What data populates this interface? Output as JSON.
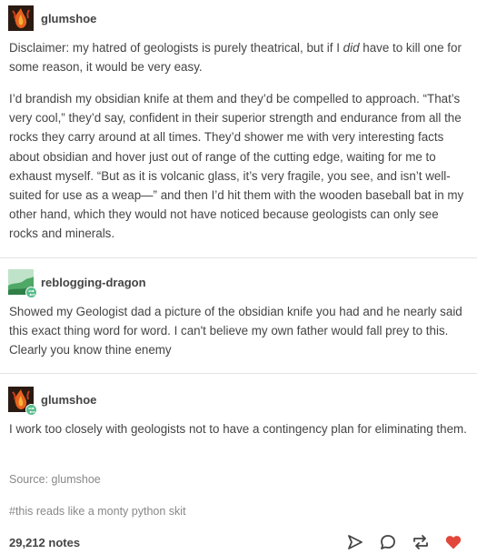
{
  "post1": {
    "username": "glumshoe",
    "para1_before": "Disclaimer: my hatred of geologists is purely theatrical, but if I ",
    "para1_em": "did",
    "para1_after": " have to kill one for some reason, it would be very easy.",
    "para2": "I’d brandish my obsidian knife at them and they’d be compelled to approach. “That’s very cool,” they’d say, confident in their superior strength and endurance from all the rocks they carry around at all times. They’d shower me with very interesting facts about obsidian and hover just out of range of the cutting edge, waiting for me to exhaust myself. “But as it is volcanic glass, it’s very fragile, you see, and isn’t well-suited for use as a weap—” and then I’d hit them with the wooden baseball bat in my other hand, which they would not have noticed because geologists can only see rocks and minerals."
  },
  "post2": {
    "username": "reblogging-dragon",
    "body": "Showed my Geologist dad a picture of the obsidian knife you had and he nearly said this exact thing word for word. I can't believe my own father would fall prey to this. Clearly you know thine enemy"
  },
  "post3": {
    "username": "glumshoe",
    "body": "I work too closely with geologists not to have a contingency plan for eliminating them."
  },
  "source": "Source:  glumshoe",
  "tag": "#this reads like a monty python skit",
  "notes": "29,212 notes",
  "colors": {
    "text": "#444444",
    "muted": "#888888",
    "like": "#e2473b",
    "reblog_badge": "#56bc8a"
  },
  "icons": [
    "share-icon",
    "reply-icon",
    "reblog-icon",
    "like-icon"
  ]
}
